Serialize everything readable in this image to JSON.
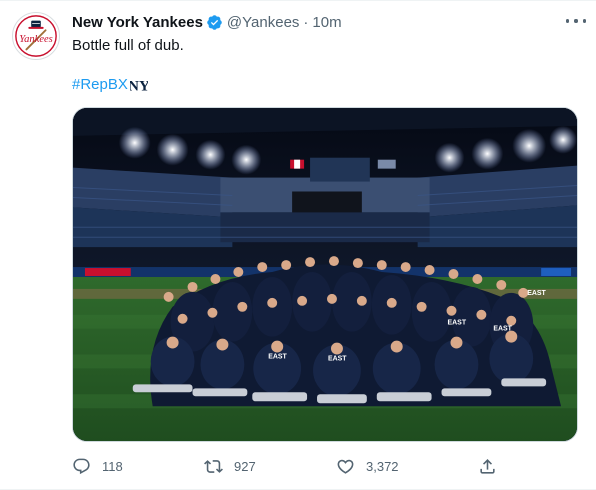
{
  "tweet": {
    "author_name": "New York Yankees",
    "author_handle": "@Yankees",
    "separator": "·",
    "time": "10m",
    "text": "Bottle full of dub.",
    "hashtag": "#RepBX",
    "avatar_text": "Yankees",
    "ny_logo_text": "NY",
    "verified": true
  },
  "media": {
    "alt": "Team celebration photo on the field",
    "shirt_text": "EAST"
  },
  "actions": {
    "replies": "118",
    "retweets": "927",
    "likes": "3,372"
  },
  "colors": {
    "accent": "#1d9bf0",
    "text": "#0f1419",
    "muted": "#536471"
  },
  "icons": [
    "verified-badge-icon",
    "more-icon",
    "ny-emoji-icon",
    "reply-icon",
    "retweet-icon",
    "like-icon",
    "share-icon"
  ]
}
